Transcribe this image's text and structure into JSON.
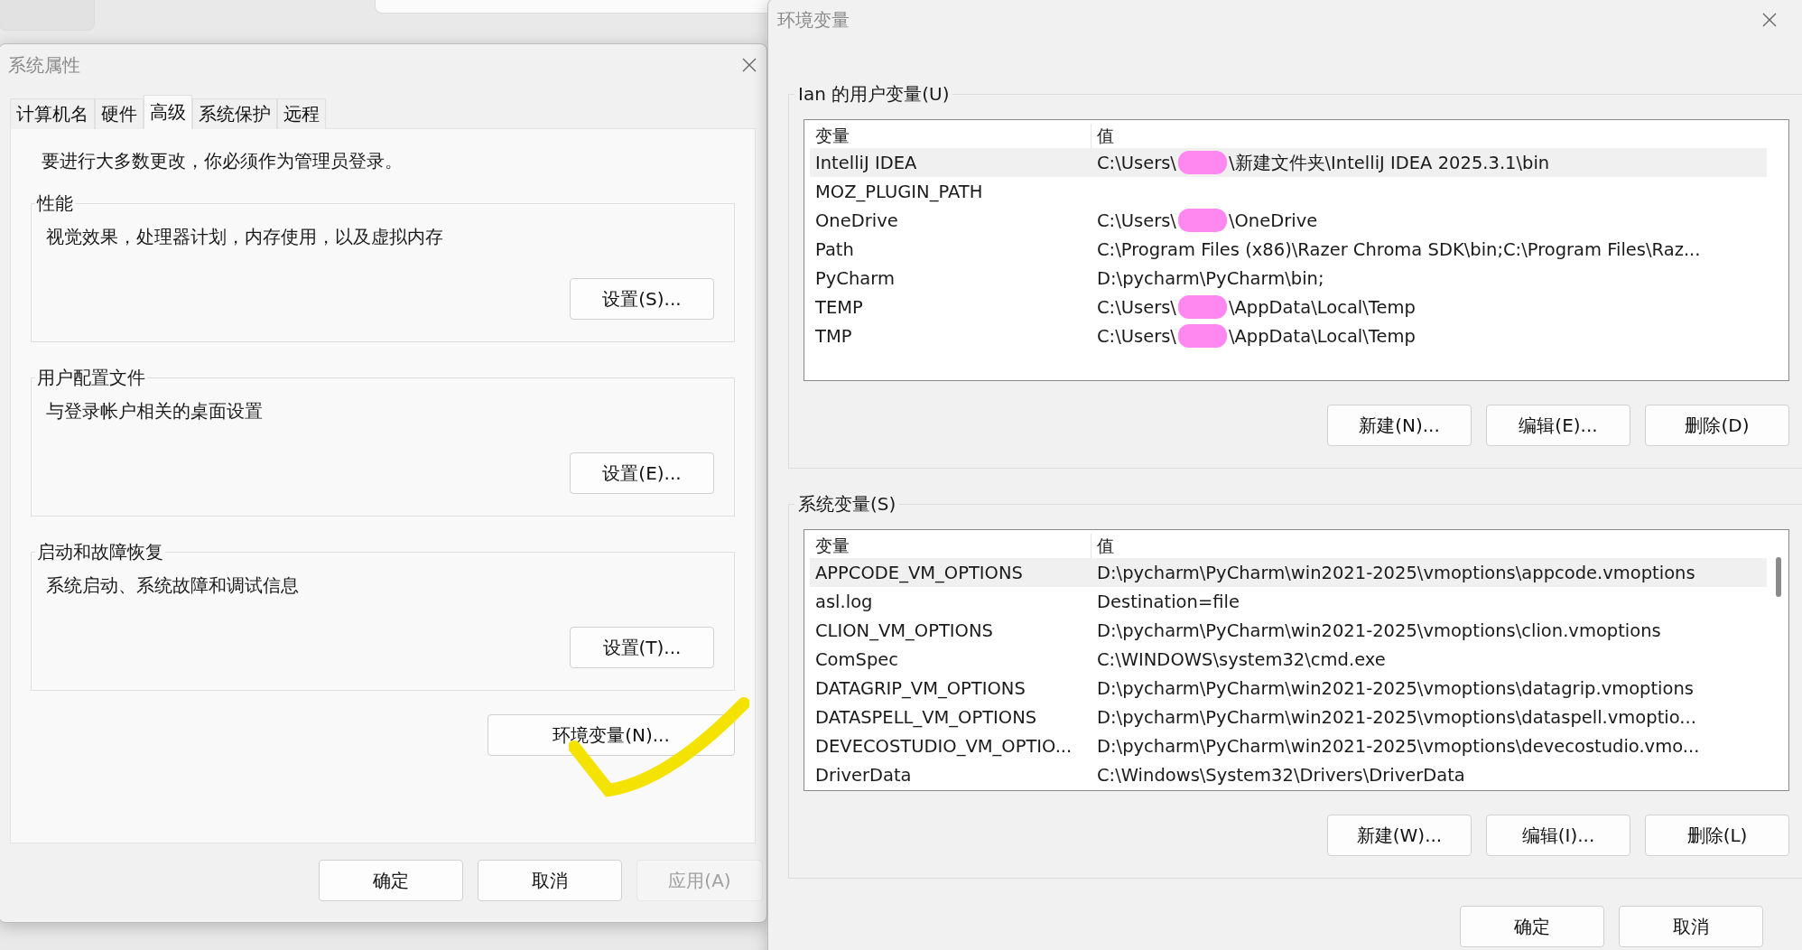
{
  "system_properties": {
    "title": "系统属性",
    "tabs": [
      {
        "label": "计算机名",
        "selected": false
      },
      {
        "label": "硬件",
        "selected": false
      },
      {
        "label": "高级",
        "selected": true
      },
      {
        "label": "系统保护",
        "selected": false
      },
      {
        "label": "远程",
        "selected": false
      }
    ],
    "notice": "要进行大多数更改，你必须作为管理员登录。",
    "groups": [
      {
        "title": "性能",
        "description": "视觉效果，处理器计划，内存使用，以及虚拟内存",
        "button": "设置(S)..."
      },
      {
        "title": "用户配置文件",
        "description": "与登录帐户相关的桌面设置",
        "button": "设置(E)..."
      },
      {
        "title": "启动和故障恢复",
        "description": "系统启动、系统故障和调试信息",
        "button": "设置(T)..."
      }
    ],
    "env_button": {
      "label": "环境变量(N)...",
      "annotated": true
    },
    "buttons": [
      {
        "label": "确定",
        "disabled": false
      },
      {
        "label": "取消",
        "disabled": false
      },
      {
        "label": "应用(A)",
        "disabled": true
      }
    ]
  },
  "environment_variables": {
    "title": "环境变量",
    "sections": [
      {
        "title": "Ian 的用户变量(U)",
        "columns": [
          "变量",
          "值"
        ],
        "scrollbar": false,
        "rows": [
          {
            "name": "IntelliJ IDEA",
            "value": "C:\\Users\\",
            "redacted": true,
            "value_after": "\\新建文件夹\\IntelliJ IDEA 2025.3.1\\bin",
            "selected": true
          },
          {
            "name": "MOZ_PLUGIN_PATH",
            "value": "",
            "redacted": false,
            "selected": false
          },
          {
            "name": "OneDrive",
            "value": "C:\\Users\\",
            "redacted": true,
            "value_after": "\\OneDrive",
            "selected": false
          },
          {
            "name": "Path",
            "value": "C:\\Program Files (x86)\\Razer Chroma SDK\\bin;C:\\Program Files\\Raz...",
            "redacted": false,
            "selected": false
          },
          {
            "name": "PyCharm",
            "value": "D:\\pycharm\\PyCharm\\bin;",
            "redacted": false,
            "selected": false
          },
          {
            "name": "TEMP",
            "value": "C:\\Users\\",
            "redacted": true,
            "value_after": "\\AppData\\Local\\Temp",
            "selected": false
          },
          {
            "name": "TMP",
            "value": "C:\\Users\\",
            "redacted": true,
            "value_after": "\\AppData\\Local\\Temp",
            "selected": false
          }
        ],
        "buttons": [
          "新建(N)...",
          "编辑(E)...",
          "删除(D)"
        ]
      },
      {
        "title": "系统变量(S)",
        "columns": [
          "变量",
          "值"
        ],
        "scrollbar": true,
        "rows": [
          {
            "name": "APPCODE_VM_OPTIONS",
            "value": "D:\\pycharm\\PyCharm\\win2021-2025\\vmoptions\\appcode.vmoptions",
            "redacted": false,
            "selected": true
          },
          {
            "name": "asl.log",
            "value": "Destination=file",
            "redacted": false,
            "selected": false
          },
          {
            "name": "CLION_VM_OPTIONS",
            "value": "D:\\pycharm\\PyCharm\\win2021-2025\\vmoptions\\clion.vmoptions",
            "redacted": false,
            "selected": false
          },
          {
            "name": "ComSpec",
            "value": "C:\\WINDOWS\\system32\\cmd.exe",
            "redacted": false,
            "selected": false
          },
          {
            "name": "DATAGRIP_VM_OPTIONS",
            "value": "D:\\pycharm\\PyCharm\\win2021-2025\\vmoptions\\datagrip.vmoptions",
            "redacted": false,
            "selected": false
          },
          {
            "name": "DATASPELL_VM_OPTIONS",
            "value": "D:\\pycharm\\PyCharm\\win2021-2025\\vmoptions\\dataspell.vmoptio...",
            "redacted": false,
            "selected": false
          },
          {
            "name": "DEVECOSTUDIO_VM_OPTIO...",
            "value": "D:\\pycharm\\PyCharm\\win2021-2025\\vmoptions\\devecostudio.vmo...",
            "redacted": false,
            "selected": false
          },
          {
            "name": "DriverData",
            "value": "C:\\Windows\\System32\\Drivers\\DriverData",
            "redacted": false,
            "selected": false
          }
        ],
        "buttons": [
          "新建(W)...",
          "编辑(I)...",
          "删除(L)"
        ]
      }
    ],
    "buttons": [
      "确定",
      "取消"
    ]
  }
}
